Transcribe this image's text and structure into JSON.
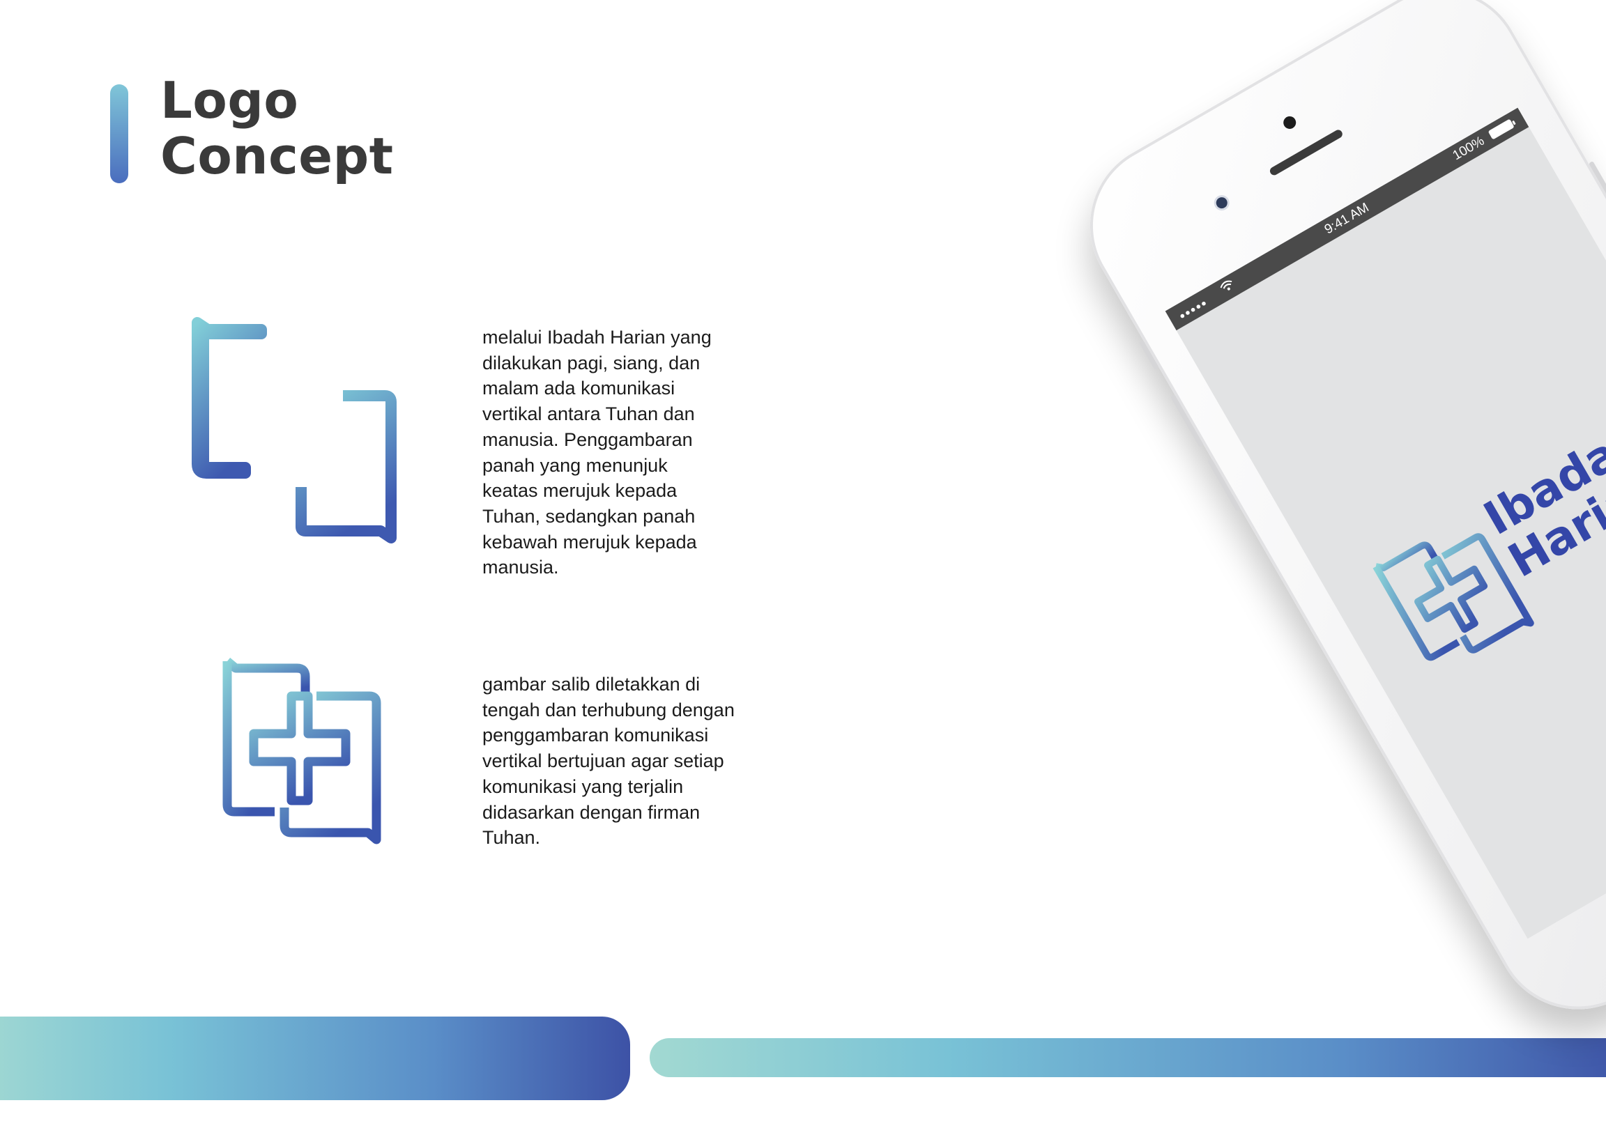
{
  "heading": {
    "line1": "Logo",
    "line2": "Concept"
  },
  "concept": [
    {
      "icon": "chat-bubbles-arrows-icon",
      "text": "melalui Ibadah Harian yang\ndilakukan pagi, siang, dan\nmalam ada komunikasi\nvertikal antara Tuhan dan\nmanusia. Penggambaran\npanah yang menunjuk\nkeatas merujuk kepada\nTuhan, sedangkan panah\nkebawah merujuk kepada\nmanusia."
    },
    {
      "icon": "chat-bubbles-cross-icon",
      "text": "gambar salib diletakkan di\ntengah dan terhubung dengan\npenggambaran komunikasi\nvertikal bertujuan agar setiap\nkomunikasi yang terjalin\ndidasarkan dengan firman\nTuhan."
    }
  ],
  "phone": {
    "status": {
      "signal": "●●●●●",
      "wifi": "wifi-icon",
      "time": "9:41 AM",
      "battery": "100%"
    },
    "app_name": {
      "line1": "Ibadah",
      "line2": "Harian"
    }
  },
  "colors": {
    "gradient_start": "#a2d9d2",
    "gradient_mid": "#79c2d6",
    "gradient_end": "#3d52a6",
    "heading_text": "#3a3a3a",
    "wordmark": "#3446a8",
    "screen_bg": "#e2e3e4",
    "status_bar": "#4a4a4a"
  }
}
